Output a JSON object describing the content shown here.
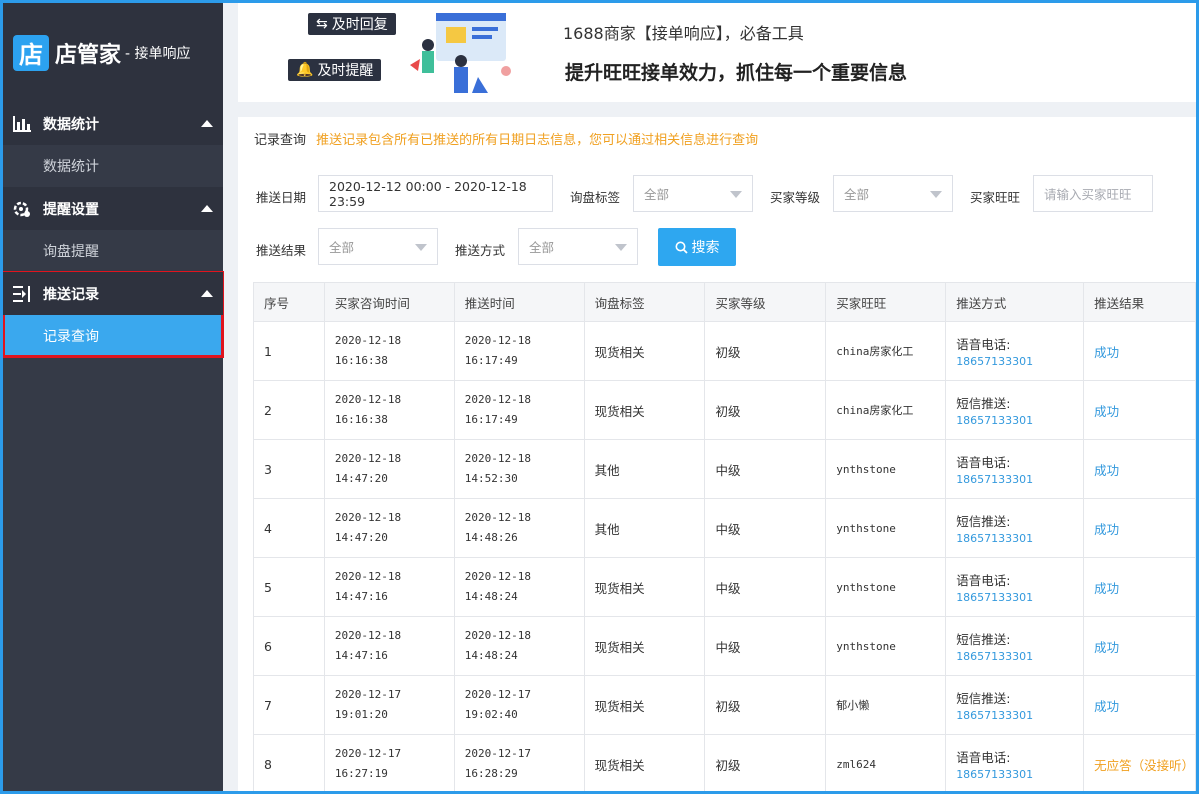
{
  "sidebar": {
    "logo_char": "店",
    "logo_name": "店管家",
    "logo_sub": "- 接单响应",
    "groups": [
      {
        "title": "数据统计",
        "items": [
          "数据统计"
        ]
      },
      {
        "title": "提醒设置",
        "items": [
          "询盘提醒"
        ]
      },
      {
        "title": "推送记录",
        "items": [
          "记录查询"
        ]
      }
    ]
  },
  "banner": {
    "tag1": "及时回复",
    "tag2": "及时提醒",
    "line1": "1688商家【接单响应】，必备工具",
    "line2": "提升旺旺接单效力，抓住每一个重要信息"
  },
  "crumb": {
    "title": "记录查询",
    "tip": "推送记录包含所有已推送的所有日期日志信息，您可以通过相关信息进行查询"
  },
  "filters": {
    "date_label": "推送日期",
    "date_value": "2020-12-12 00:00 - 2020-12-18 23:59",
    "tag_label": "询盘标签",
    "tag_value": "全部",
    "level_label": "买家等级",
    "level_value": "全部",
    "ww_label": "买家旺旺",
    "ww_placeholder": "请输入买家旺旺",
    "result_label": "推送结果",
    "result_value": "全部",
    "method_label": "推送方式",
    "method_value": "全部",
    "search_label": "搜索"
  },
  "table": {
    "headers": [
      "序号",
      "买家咨询时间",
      "推送时间",
      "询盘标签",
      "买家等级",
      "买家旺旺",
      "推送方式",
      "推送结果"
    ],
    "rows": [
      {
        "no": "1",
        "ask_date": "2020-12-18",
        "ask_time": "16:16:38",
        "push_date": "2020-12-18",
        "push_time": "16:17:49",
        "tag": "现货相关",
        "level": "初级",
        "ww": "china房家化工",
        "method": "语音电话:",
        "phone": "18657133301",
        "result": "成功"
      },
      {
        "no": "2",
        "ask_date": "2020-12-18",
        "ask_time": "16:16:38",
        "push_date": "2020-12-18",
        "push_time": "16:17:49",
        "tag": "现货相关",
        "level": "初级",
        "ww": "china房家化工",
        "method": "短信推送:",
        "phone": "18657133301",
        "result": "成功"
      },
      {
        "no": "3",
        "ask_date": "2020-12-18",
        "ask_time": "14:47:20",
        "push_date": "2020-12-18",
        "push_time": "14:52:30",
        "tag": "其他",
        "level": "中级",
        "ww": "ynthstone",
        "method": "语音电话:",
        "phone": "18657133301",
        "result": "成功"
      },
      {
        "no": "4",
        "ask_date": "2020-12-18",
        "ask_time": "14:47:20",
        "push_date": "2020-12-18",
        "push_time": "14:48:26",
        "tag": "其他",
        "level": "中级",
        "ww": "ynthstone",
        "method": "短信推送:",
        "phone": "18657133301",
        "result": "成功"
      },
      {
        "no": "5",
        "ask_date": "2020-12-18",
        "ask_time": "14:47:16",
        "push_date": "2020-12-18",
        "push_time": "14:48:24",
        "tag": "现货相关",
        "level": "中级",
        "ww": "ynthstone",
        "method": "语音电话:",
        "phone": "18657133301",
        "result": "成功"
      },
      {
        "no": "6",
        "ask_date": "2020-12-18",
        "ask_time": "14:47:16",
        "push_date": "2020-12-18",
        "push_time": "14:48:24",
        "tag": "现货相关",
        "level": "中级",
        "ww": "ynthstone",
        "method": "短信推送:",
        "phone": "18657133301",
        "result": "成功"
      },
      {
        "no": "7",
        "ask_date": "2020-12-17",
        "ask_time": "19:01:20",
        "push_date": "2020-12-17",
        "push_time": "19:02:40",
        "tag": "现货相关",
        "level": "初级",
        "ww": "郁小懒",
        "method": "短信推送:",
        "phone": "18657133301",
        "result": "成功"
      },
      {
        "no": "8",
        "ask_date": "2020-12-17",
        "ask_time": "16:27:19",
        "push_date": "2020-12-17",
        "push_time": "16:28:29",
        "tag": "现货相关",
        "level": "初级",
        "ww": "zml624",
        "method": "语音电话:",
        "phone": "18657133301",
        "result": "无应答（没接听）",
        "warn": true
      }
    ]
  },
  "colors": {
    "accent": "#2ea7f0",
    "sidebar": "#353a47",
    "warning": "#f0a020",
    "highlight": "#e0141e"
  }
}
